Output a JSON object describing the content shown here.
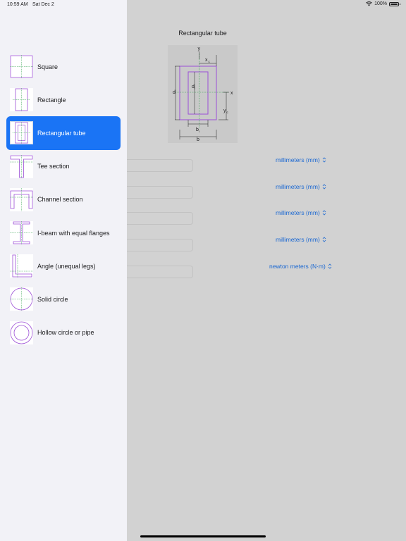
{
  "status_bar": {
    "time": "10:59 AM",
    "date": "Sat Dec 2",
    "battery": "100%"
  },
  "sidebar": {
    "items": [
      {
        "label": "Square",
        "icon": "square-section-icon",
        "selected": false
      },
      {
        "label": "Rectangle",
        "icon": "rectangle-section-icon",
        "selected": false
      },
      {
        "label": "Rectangular tube",
        "icon": "rectangular-tube-icon",
        "selected": true
      },
      {
        "label": "Tee section",
        "icon": "tee-section-icon",
        "selected": false
      },
      {
        "label": "Channel section",
        "icon": "channel-section-icon",
        "selected": false
      },
      {
        "label": "I-beam with equal flanges",
        "icon": "i-beam-icon",
        "selected": false
      },
      {
        "label": "Angle (unequal legs)",
        "icon": "angle-section-icon",
        "selected": false
      },
      {
        "label": "Solid circle",
        "icon": "solid-circle-icon",
        "selected": false
      },
      {
        "label": "Hollow circle or pipe",
        "icon": "hollow-circle-icon",
        "selected": false
      }
    ]
  },
  "main": {
    "title": "Rectangular tube",
    "diagram_labels": {
      "y": "y",
      "x": "x",
      "xc": "x",
      "xc_sub": "c",
      "yc": "y",
      "yc_sub": "c",
      "d": "d",
      "di": "d",
      "di_sub": "i",
      "bi": "b",
      "bi_sub": "i",
      "b": "b"
    },
    "inputs": [
      {
        "unit": "millimeters (mm)"
      },
      {
        "unit": "millimeters (mm)"
      },
      {
        "unit": "millimeters (mm)"
      },
      {
        "unit": "millimeters (mm)"
      },
      {
        "unit": "newton meters (N·m)"
      }
    ]
  },
  "colors": {
    "accent": "#1a74f5",
    "link": "#1967d2",
    "section_outline": "#9c4fd6",
    "centroid_line": "#3aa655"
  }
}
